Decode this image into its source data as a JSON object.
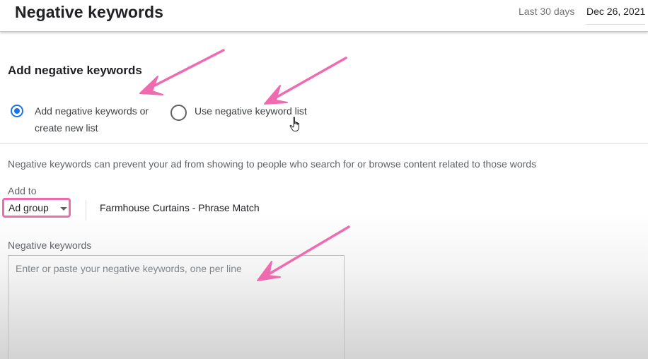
{
  "header": {
    "title": "Negative keywords",
    "date_range_label": "Last 30 days",
    "date_range_value": "Dec 26, 2021"
  },
  "section": {
    "title": "Add negative keywords"
  },
  "options": {
    "add_new": {
      "line1": "Add negative keywords or",
      "line2": "create new list",
      "selected": true
    },
    "use_list": {
      "label": "Use negative keyword list",
      "selected": false
    }
  },
  "description": "Negative keywords can prevent your ad from showing to people who search for or browse content related to those words",
  "add_to": {
    "label": "Add to",
    "selected": "Ad group",
    "target_name": "Farmhouse Curtains - Phrase Match"
  },
  "negative_keywords": {
    "label": "Negative keywords",
    "placeholder": "Enter or paste your negative keywords, one per line",
    "value": ""
  },
  "annotation": {
    "arrow_color": "#f06ab0",
    "highlight_color": "#f06ab0"
  },
  "colors": {
    "accent": "#1a73e8"
  }
}
